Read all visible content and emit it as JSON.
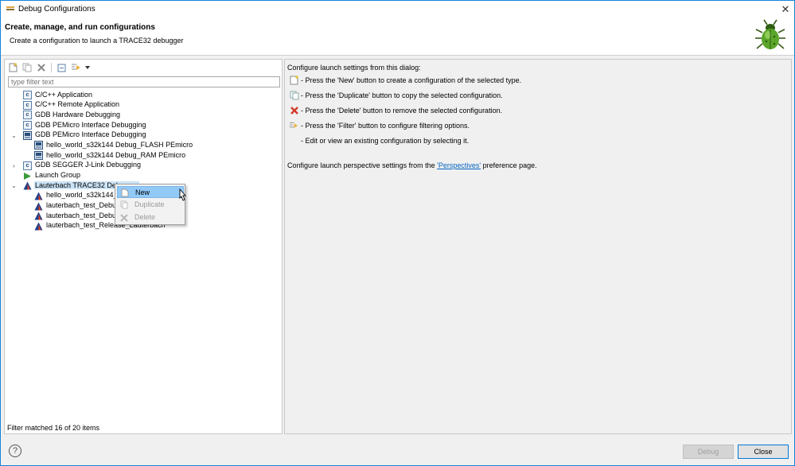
{
  "window": {
    "title": "Debug Configurations",
    "close_glyph": "✕"
  },
  "header": {
    "title": "Create, manage, and run configurations",
    "subtitle": "Create a configuration to launch a TRACE32 debugger"
  },
  "filter": {
    "placeholder": "type filter text"
  },
  "tree": {
    "items": [
      {
        "label": "C/C++ Application",
        "icon": "c-config-icon"
      },
      {
        "label": "C/C++ Remote Application",
        "icon": "c-config-icon"
      },
      {
        "label": "GDB Hardware Debugging",
        "icon": "c-config-icon"
      },
      {
        "label": "GDB PEMicro Interface Debugging",
        "icon": "c-config-icon"
      },
      {
        "label": "GDB PEMicro Interface Debugging",
        "icon": "pemicro-icon",
        "expanded": true
      },
      {
        "label": "hello_world_s32k144 Debug_FLASH PEmicro",
        "icon": "pemicro-icon"
      },
      {
        "label": "hello_world_s32k144 Debug_RAM PEmicro",
        "icon": "pemicro-icon"
      },
      {
        "label": "GDB SEGGER J-Link Debugging",
        "icon": "c-config-icon",
        "expanded": false
      },
      {
        "label": "Launch Group",
        "icon": "launch-group-icon"
      },
      {
        "label": "Lauterbach TRACE32 Debugger",
        "icon": "lauterbach-icon",
        "expanded": true,
        "selected": true
      },
      {
        "label": "hello_world_s32k144_lauterbach",
        "icon": "lauterbach-icon"
      },
      {
        "label": "lauterbach_test_Debug_Lauterbach",
        "icon": "lauterbach-icon"
      },
      {
        "label": "lauterbach_test_Debug_RAM_Lauterbach",
        "icon": "lauterbach-icon"
      },
      {
        "label": "lauterbach_test_Release_Lauterbach",
        "icon": "lauterbach-icon"
      }
    ]
  },
  "context_menu": {
    "items": [
      {
        "label": "New",
        "enabled": true,
        "highlighted": true
      },
      {
        "label": "Duplicate",
        "enabled": false
      },
      {
        "label": "Delete",
        "enabled": false
      }
    ]
  },
  "status": {
    "text": "Filter matched 16 of 20 items"
  },
  "info": {
    "intro": "Configure launch settings from this dialog:",
    "lines": [
      {
        "text": "- Press the 'New' button to create a configuration of the selected type.",
        "icon": "new-config-icon"
      },
      {
        "text": "- Press the 'Duplicate' button to copy the selected configuration.",
        "icon": "duplicate-icon"
      },
      {
        "text": "- Press the 'Delete' button to remove the selected configuration.",
        "icon": "delete-icon"
      },
      {
        "text": "- Press the 'Filter' button to configure filtering options.",
        "icon": "filter-icon"
      },
      {
        "text": "- Edit or view an existing configuration by selecting it.",
        "icon": ""
      }
    ],
    "perspective_prefix": "Configure launch perspective settings from the ",
    "perspective_link": "'Perspectives'",
    "perspective_suffix": " preference page."
  },
  "buttons": {
    "debug": "Debug",
    "close": "Close",
    "help": "?"
  }
}
